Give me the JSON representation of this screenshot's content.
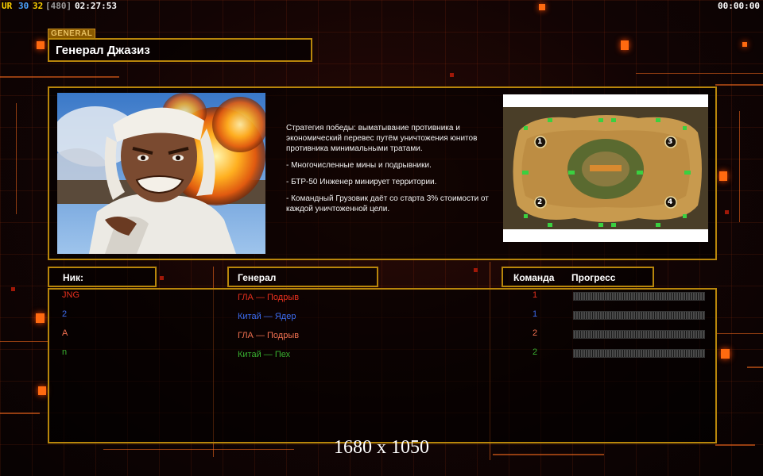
{
  "topbar": {
    "fps_a": "UR",
    "fps_b": "30",
    "fps_c": "32",
    "fps_d": "[480]",
    "clock": "02:27:53",
    "timer": "00:00:00"
  },
  "general": {
    "tag": "GENERAL",
    "name": "Генерал Джазиз",
    "description": [
      "Стратегия победы: выматывание противника и экономический перевес путём уничтожения юнитов противника минимальными тратами.",
      "- Многочисленные мины и подрывники.",
      "- БТР-50 Инженер минирует территории.",
      "- Командный Грузовик даёт со старта 3% стоимости от каждой уничтоженной цели."
    ],
    "map_slots": [
      "1",
      "2",
      "3",
      "4"
    ]
  },
  "columns": {
    "nick": "Ник:",
    "general": "Генерал",
    "team": "Команда",
    "progress": "Прогресс"
  },
  "players": [
    {
      "nick": "JNG",
      "general": "ГЛА — Подрыв",
      "team": "1",
      "color": "#e8301e",
      "progress": 0
    },
    {
      "nick": "2",
      "general": "Китай — Ядер",
      "team": "1",
      "color": "#3c6cf0",
      "progress": 0
    },
    {
      "nick": "A",
      "general": "ГЛА — Подрыв",
      "team": "2",
      "color": "#f07050",
      "progress": 0
    },
    {
      "nick": "n",
      "general": "Китай — Пех",
      "team": "2",
      "color": "#38b030",
      "progress": 0
    }
  ],
  "resolution": "1680 x 1050",
  "colors": {
    "frame": "#b8860b",
    "accent": "#ff6a10"
  }
}
